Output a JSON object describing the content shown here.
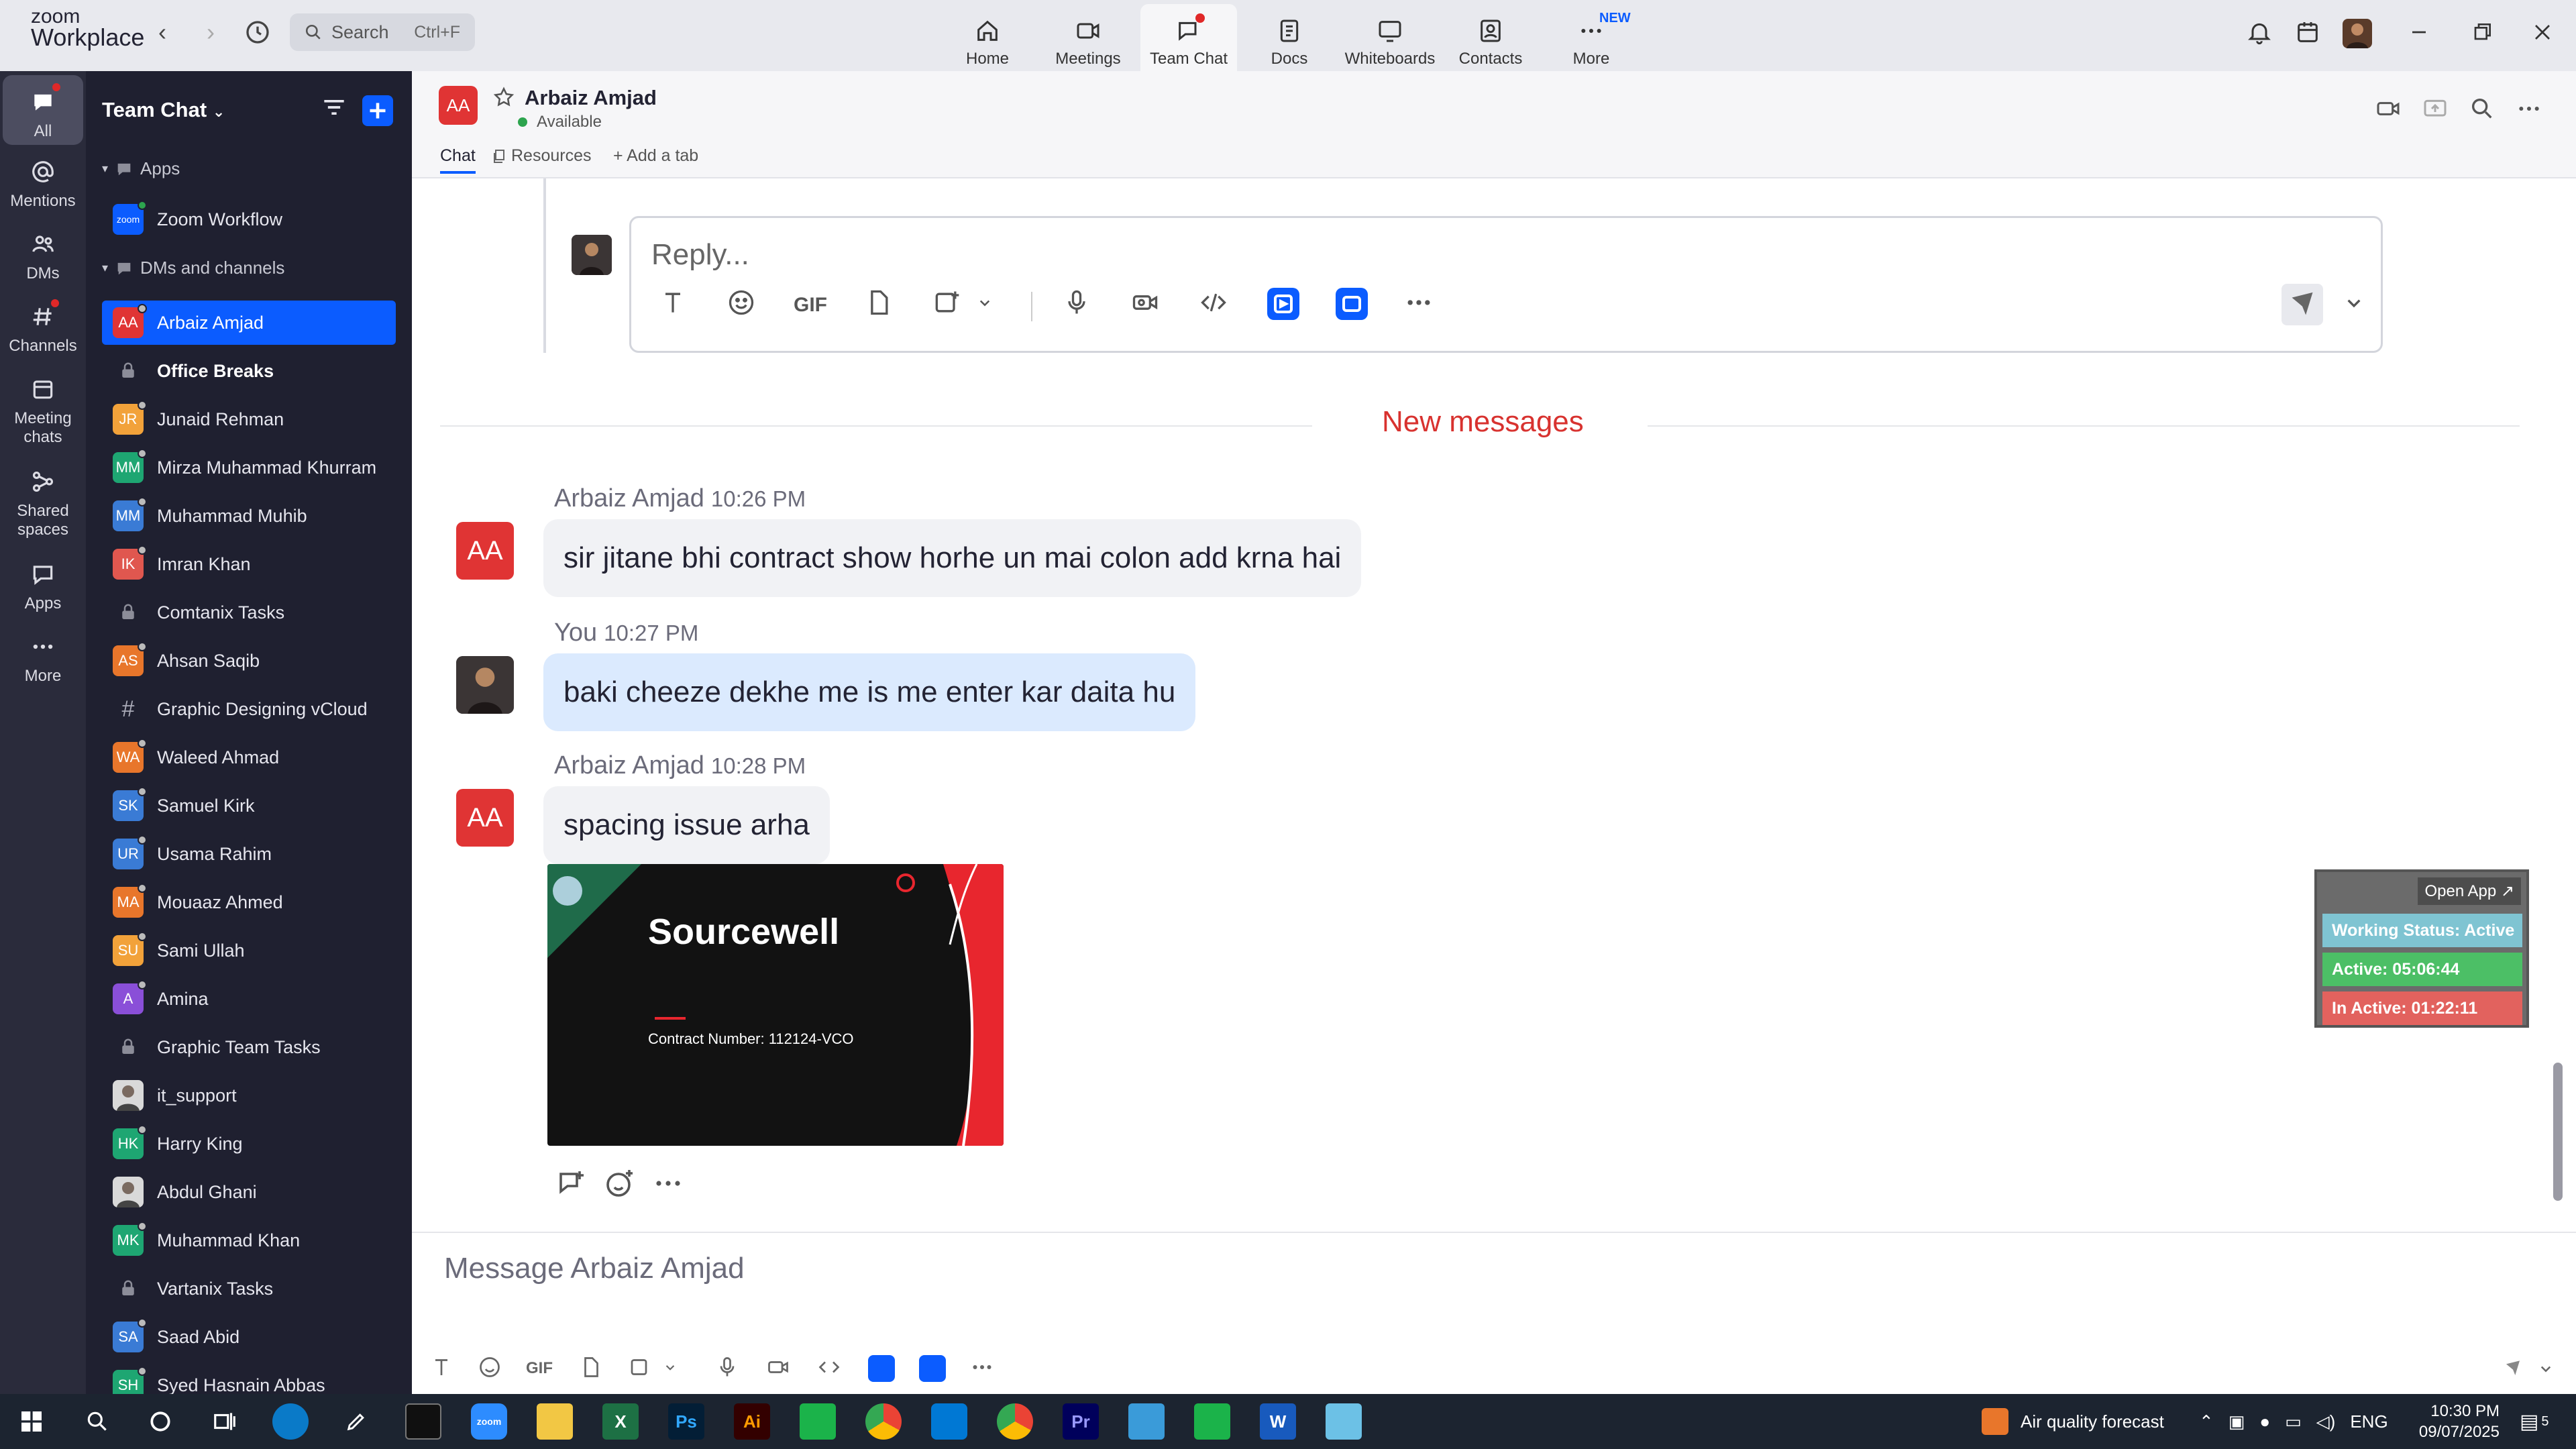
{
  "app": {
    "brand_top": "zoom",
    "brand_bottom": "Workplace"
  },
  "topbar": {
    "search_label": "Search",
    "search_shortcut": "Ctrl+F",
    "tabs": [
      {
        "label": "Home",
        "icon": "home-icon"
      },
      {
        "label": "Meetings",
        "icon": "video-icon"
      },
      {
        "label": "Team Chat",
        "icon": "chat-icon"
      },
      {
        "label": "Docs",
        "icon": "docs-icon"
      },
      {
        "label": "Whiteboards",
        "icon": "whiteboard-icon"
      },
      {
        "label": "Contacts",
        "icon": "contacts-icon"
      },
      {
        "label": "More",
        "icon": "more-icon",
        "badge": "NEW"
      }
    ],
    "active_tab": "Team Chat"
  },
  "rail": {
    "items": [
      {
        "label": "All",
        "icon": "chat-bubble-icon"
      },
      {
        "label": "Mentions",
        "icon": "at-icon"
      },
      {
        "label": "DMs",
        "icon": "people-icon"
      },
      {
        "label": "Channels",
        "icon": "hash-icon"
      },
      {
        "label": "Meeting chats",
        "icon": "calendar-icon"
      },
      {
        "label": "Shared spaces",
        "icon": "shared-icon"
      },
      {
        "label": "Apps",
        "icon": "apps-icon"
      },
      {
        "label": "More",
        "icon": "ellipsis-icon"
      }
    ]
  },
  "sidebar": {
    "title": "Team Chat",
    "sections": {
      "apps": "Apps",
      "dms": "DMs and channels"
    },
    "app_item": {
      "label": "Zoom Workflow",
      "avatar": "zoom"
    },
    "items": [
      {
        "name": "Arbaiz Amjad",
        "initials": "AA",
        "color": "#e03434",
        "active": true
      },
      {
        "name": "Office Breaks",
        "initials": "",
        "type": "lock",
        "bold": true
      },
      {
        "name": "Junaid Rehman",
        "initials": "JR",
        "color": "#f2a23a"
      },
      {
        "name": "Mirza Muhammad Khurram",
        "initials": "MM",
        "color": "#1ea672"
      },
      {
        "name": "Muhammad Muhib",
        "initials": "MM",
        "color": "#3a7bd5"
      },
      {
        "name": "Imran Khan",
        "initials": "IK",
        "color": "#e0574f"
      },
      {
        "name": "Comtanix Tasks",
        "initials": "",
        "type": "lock"
      },
      {
        "name": "Ahsan Saqib",
        "initials": "AS",
        "color": "#e8762b"
      },
      {
        "name": "Graphic Designing vCloud",
        "initials": "",
        "type": "hash"
      },
      {
        "name": "Waleed Ahmad",
        "initials": "WA",
        "color": "#e8762b"
      },
      {
        "name": "Samuel Kirk",
        "initials": "SK",
        "color": "#3a7bd5"
      },
      {
        "name": "Usama Rahim",
        "initials": "UR",
        "color": "#3a7bd5"
      },
      {
        "name": "Mouaaz Ahmed",
        "initials": "MA",
        "color": "#e8762b"
      },
      {
        "name": "Sami Ullah",
        "initials": "SU",
        "color": "#f2a23a"
      },
      {
        "name": "Amina",
        "initials": "A",
        "color": "#8a4fd8"
      },
      {
        "name": "Graphic Team Tasks",
        "initials": "",
        "type": "lock"
      },
      {
        "name": "it_support",
        "initials": "",
        "type": "photo"
      },
      {
        "name": "Harry King",
        "initials": "HK",
        "color": "#1ea672"
      },
      {
        "name": "Abdul Ghani",
        "initials": "",
        "type": "photo"
      },
      {
        "name": "Muhammad Khan",
        "initials": "MK",
        "color": "#1ea672"
      },
      {
        "name": "Vartanix Tasks",
        "initials": "",
        "type": "lock"
      },
      {
        "name": "Saad Abid",
        "initials": "SA",
        "color": "#3a7bd5"
      },
      {
        "name": "Syed Hasnain Abbas",
        "initials": "SH",
        "color": "#1ea672"
      }
    ]
  },
  "chat": {
    "contact_name": "Arbaiz Amjad",
    "contact_initials": "AA",
    "status": "Available",
    "tabs": [
      "Chat",
      "Resources",
      "+ Add a tab"
    ],
    "reply_placeholder": "Reply...",
    "new_messages_label": "New messages",
    "messages": [
      {
        "sender": "Arbaiz Amjad",
        "time": "10:26 PM",
        "text": "sir jitane bhi contract show horhe un mai colon add krna hai"
      },
      {
        "sender": "You",
        "time": "10:27 PM",
        "text": "baki cheeze dekhe me is me enter kar daita hu"
      },
      {
        "sender": "Arbaiz Amjad",
        "time": "10:28 PM",
        "text": "spacing issue arha"
      }
    ],
    "image_preview": {
      "title": "Sourcewell",
      "subtitle": "Contract Number: 112124-VCO"
    },
    "compose_placeholder": "Message Arbaiz Amjad",
    "toolbar_gif": "GIF"
  },
  "widget": {
    "open_label": "Open App ↗",
    "working_status": "Working Status: Active",
    "active": "Active: 05:06:44",
    "inactive": "In Active: 01:22:11"
  },
  "taskbar": {
    "weather": "Air quality forecast",
    "lang": "ENG",
    "time": "10:30 PM",
    "date": "09/07/2025",
    "notif_count": "5"
  }
}
